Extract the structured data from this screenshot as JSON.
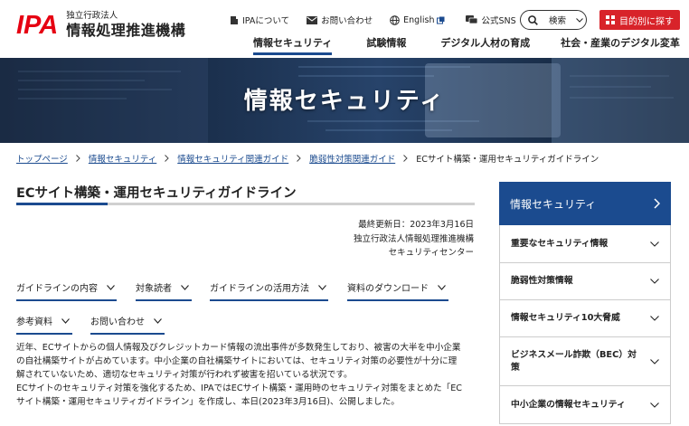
{
  "header": {
    "logo_mark": "IPA",
    "logo_small": "独立行政法人",
    "logo_large": "情報処理推進機構",
    "util_links": [
      {
        "label": "IPAについて",
        "icon": "building-icon"
      },
      {
        "label": "お問い合わせ",
        "icon": "mail-icon"
      },
      {
        "label": "English",
        "icon": "globe-icon"
      },
      {
        "label": "公式SNS",
        "icon": "chat-icon"
      }
    ],
    "search_label": "検索",
    "purpose_label": "目的別に探す",
    "main_nav": [
      "情報セキュリティ",
      "試験情報",
      "デジタル人材の育成",
      "社会・産業のデジタル変革"
    ],
    "accent_color": "#1b4b8f",
    "brand_red": "#e60012"
  },
  "hero": {
    "title": "情報セキュリティ"
  },
  "breadcrumb": {
    "items": [
      "トップページ",
      "情報セキュリティ",
      "情報セキュリティ関連ガイド",
      "脆弱性対策関連ガイド"
    ],
    "current": "ECサイト構築・運用セキュリティガイドライン"
  },
  "main": {
    "title": "ECサイト構築・運用セキュリティガイドライン",
    "meta": {
      "updated": "最終更新日：2023年3月16日",
      "org": "独立行政法人情報処理推進機構",
      "center": "セキュリティセンター"
    },
    "anchors": [
      "ガイドラインの内容",
      "対象読者",
      "ガイドラインの活用方法",
      "資料のダウンロード",
      "参考資料",
      "お問い合わせ"
    ],
    "body_lines": [
      "近年、ECサイトからの個人情報及びクレジットカード情報の流出事件が多数発生しており、被害の大半を中小企業",
      "の自社構築サイトが占めています。中小企業の自社構築サイトにおいては、セキュリティ対策の必要性が十分に理",
      "解されていないため、適切なセキュリティ対策が行われず被害を招いている状況です。",
      "ECサイトのセキュリティ対策を強化するため、IPAではECサイト構築・運用時のセキュリティ対策をまとめた「EC",
      "サイト構築・運用セキュリティガイドライン」を作成し、本日(2023年3月16日)、公開しました。"
    ]
  },
  "sidenav": {
    "title": "情報セキュリティ",
    "items": [
      {
        "label": "重要なセキュリティ情報"
      },
      {
        "label": "脆弱性対策情報"
      },
      {
        "label": "情報セキュリティ10大脅威"
      },
      {
        "label": "ビジネスメール詐欺（BEC）対策"
      },
      {
        "label": "中小企業の情報セキュリティ"
      }
    ]
  }
}
